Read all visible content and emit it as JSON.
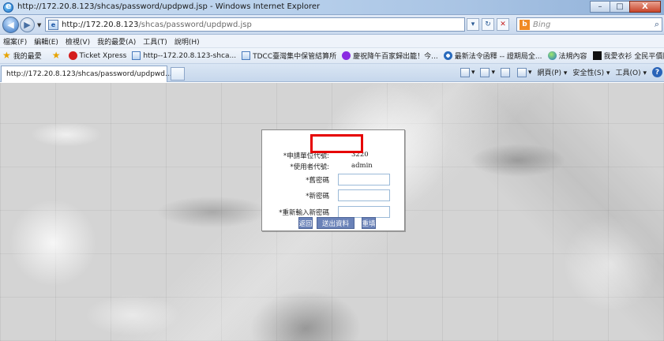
{
  "window": {
    "title": "http://172.20.8.123/shcas/password/updpwd.jsp - Windows Internet Explorer",
    "buttons": {
      "minimize": "–",
      "maximize": "□",
      "close": "X"
    }
  },
  "address_bar": {
    "url_host": "http://172.20.8.123",
    "url_path": "/shcas/password/updpwd.jsp"
  },
  "search": {
    "placeholder": "Bing"
  },
  "menu": [
    "檔案(F)",
    "編輯(E)",
    "檢視(V)",
    "我的最愛(A)",
    "工具(T)",
    "說明(H)"
  ],
  "favorites": {
    "label": "我的最愛",
    "items": [
      "Ticket Xpress",
      "http--172.20.8.123-shca...",
      "TDCC臺灣集中保管結算所",
      "慶祝降午百家歸出籠！今...",
      "最新法令函釋 -- 證期局全...",
      "法規內容",
      "我愛衣衫 全民平價服飾"
    ]
  },
  "tab": {
    "title": "http://172.20.8.123/shcas/password/updpwd...."
  },
  "command_bar": {
    "page": "網頁(P) ▾",
    "safety": "安全性(S) ▾",
    "tools": "工具(O) ▾"
  },
  "form": {
    "fields": [
      {
        "label": "*申請單位代號:",
        "value": "3220"
      },
      {
        "label": "*使用者代號:",
        "value": "admin"
      },
      {
        "label": "*舊密碼",
        "value": ""
      },
      {
        "label": "*新密碼",
        "value": ""
      },
      {
        "label": "*重新輸入新密碼",
        "value": ""
      }
    ],
    "buttons": {
      "back": "返回",
      "submit": "送出資料",
      "reset": "重填"
    }
  },
  "colors": {
    "form_button": "#6a82b8",
    "highlight_box": "#e60000"
  },
  "icons": [
    "ie-logo-icon",
    "back-arrow-icon",
    "forward-arrow-icon",
    "page-icon",
    "refresh-icon",
    "stop-icon",
    "bing-icon",
    "search-icon",
    "star-icon",
    "home-icon",
    "feeds-icon",
    "mail-icon",
    "print-icon",
    "help-icon"
  ]
}
